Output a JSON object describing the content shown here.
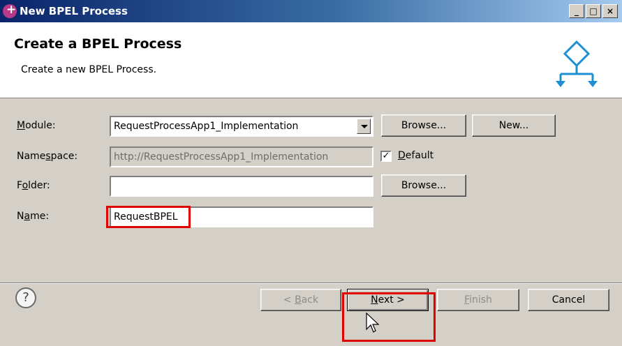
{
  "titlebar": {
    "title": "New BPEL Process",
    "minimize": "_",
    "maximize": "□",
    "close": "×"
  },
  "header": {
    "title": "Create a BPEL Process",
    "description": "Create a new BPEL Process."
  },
  "form": {
    "module": {
      "label_pre": "",
      "label_mn": "M",
      "label_post": "odule:",
      "value": "RequestProcessApp1_Implementation"
    },
    "namespace": {
      "label_pre": "Name",
      "label_mn": "s",
      "label_post": "pace:",
      "value": "http://RequestProcessApp1_Implementation"
    },
    "folder": {
      "label_pre": "F",
      "label_mn": "o",
      "label_post": "lder:",
      "value": ""
    },
    "name": {
      "label_pre": "N",
      "label_mn": "a",
      "label_post": "me:",
      "value": "RequestBPEL"
    },
    "browse_label": "Browse...",
    "new_label": "New...",
    "default_checkbox": {
      "checked": true,
      "mark": "✓",
      "label_mn": "D",
      "label_post": "efault"
    }
  },
  "footer": {
    "help": "?",
    "back": {
      "pre": "< ",
      "mn": "B",
      "post": "ack"
    },
    "next": {
      "mn": "N",
      "post": "ext >"
    },
    "finish": {
      "mn": "F",
      "post": "inish"
    },
    "cancel": "Cancel"
  }
}
